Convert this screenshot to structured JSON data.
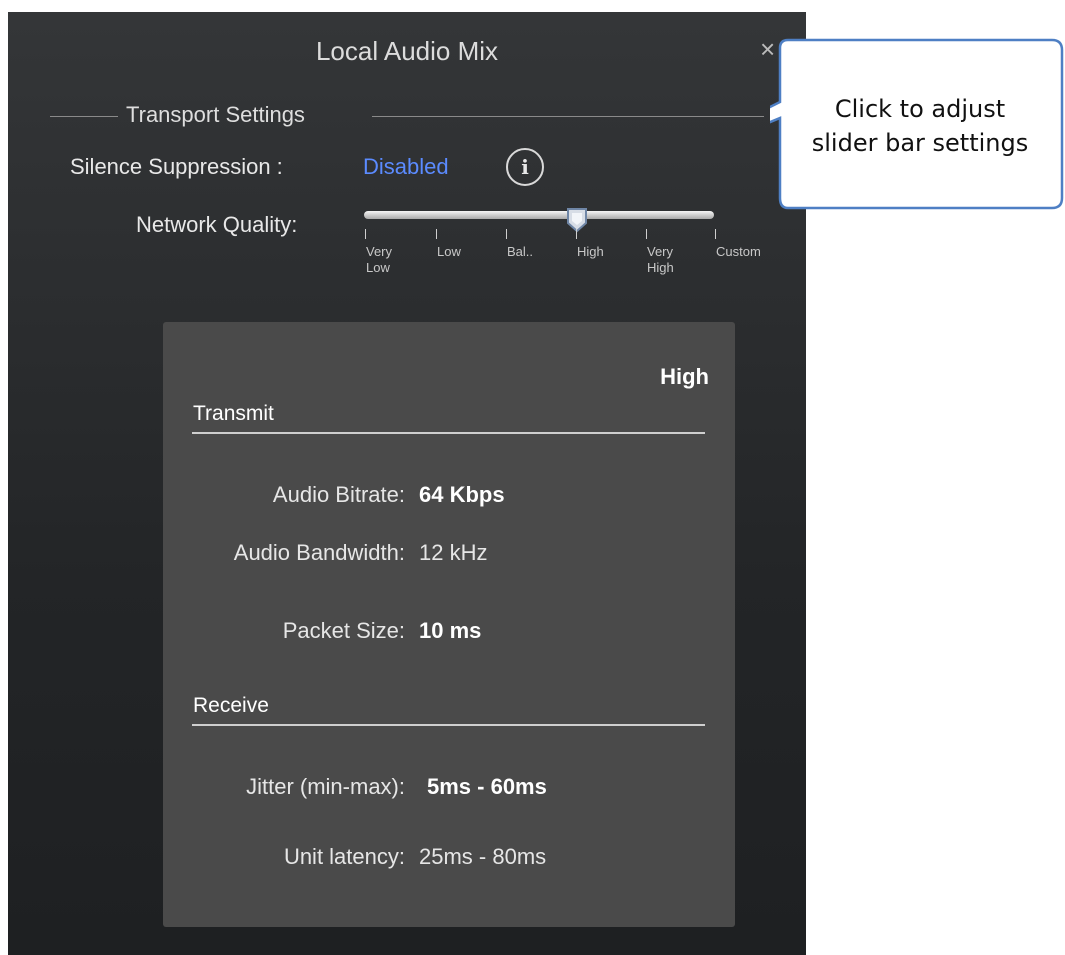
{
  "dialog": {
    "title": "Local Audio Mix",
    "close_glyph": "×",
    "section_title": "Transport Settings",
    "silence_label": "Silence Suppression :",
    "silence_value": "Disabled",
    "info_glyph": "i",
    "network_label": "Network Quality:",
    "network_levels": [
      {
        "line1": "Very",
        "line2": "Low"
      },
      {
        "line1": "Low",
        "line2": ""
      },
      {
        "line1": "Bal..",
        "line2": ""
      },
      {
        "line1": "High",
        "line2": ""
      },
      {
        "line1": "Very",
        "line2": "High"
      },
      {
        "line1": "Custom",
        "line2": ""
      }
    ],
    "selected_level_index": 3
  },
  "card": {
    "level": "High",
    "transmit_title": "Transmit",
    "audio_bitrate_label": "Audio Bitrate:",
    "audio_bitrate_value": "64 Kbps",
    "audio_bandwidth_label": "Audio Bandwidth:",
    "audio_bandwidth_value": "12 kHz",
    "packet_size_label": "Packet Size:",
    "packet_size_value": "10 ms",
    "receive_title": "Receive",
    "jitter_label": "Jitter (min-max):",
    "jitter_value": "5ms -  60ms",
    "latency_label": "Unit latency:",
    "latency_value": "25ms - 80ms"
  },
  "callout": {
    "line1": "Click to adjust",
    "line2": "slider bar settings"
  },
  "colors": {
    "panel": "#2b2d2f",
    "card": "#4a4a4a",
    "link": "#5b8bff",
    "callout_border": "#4e7fc4"
  }
}
